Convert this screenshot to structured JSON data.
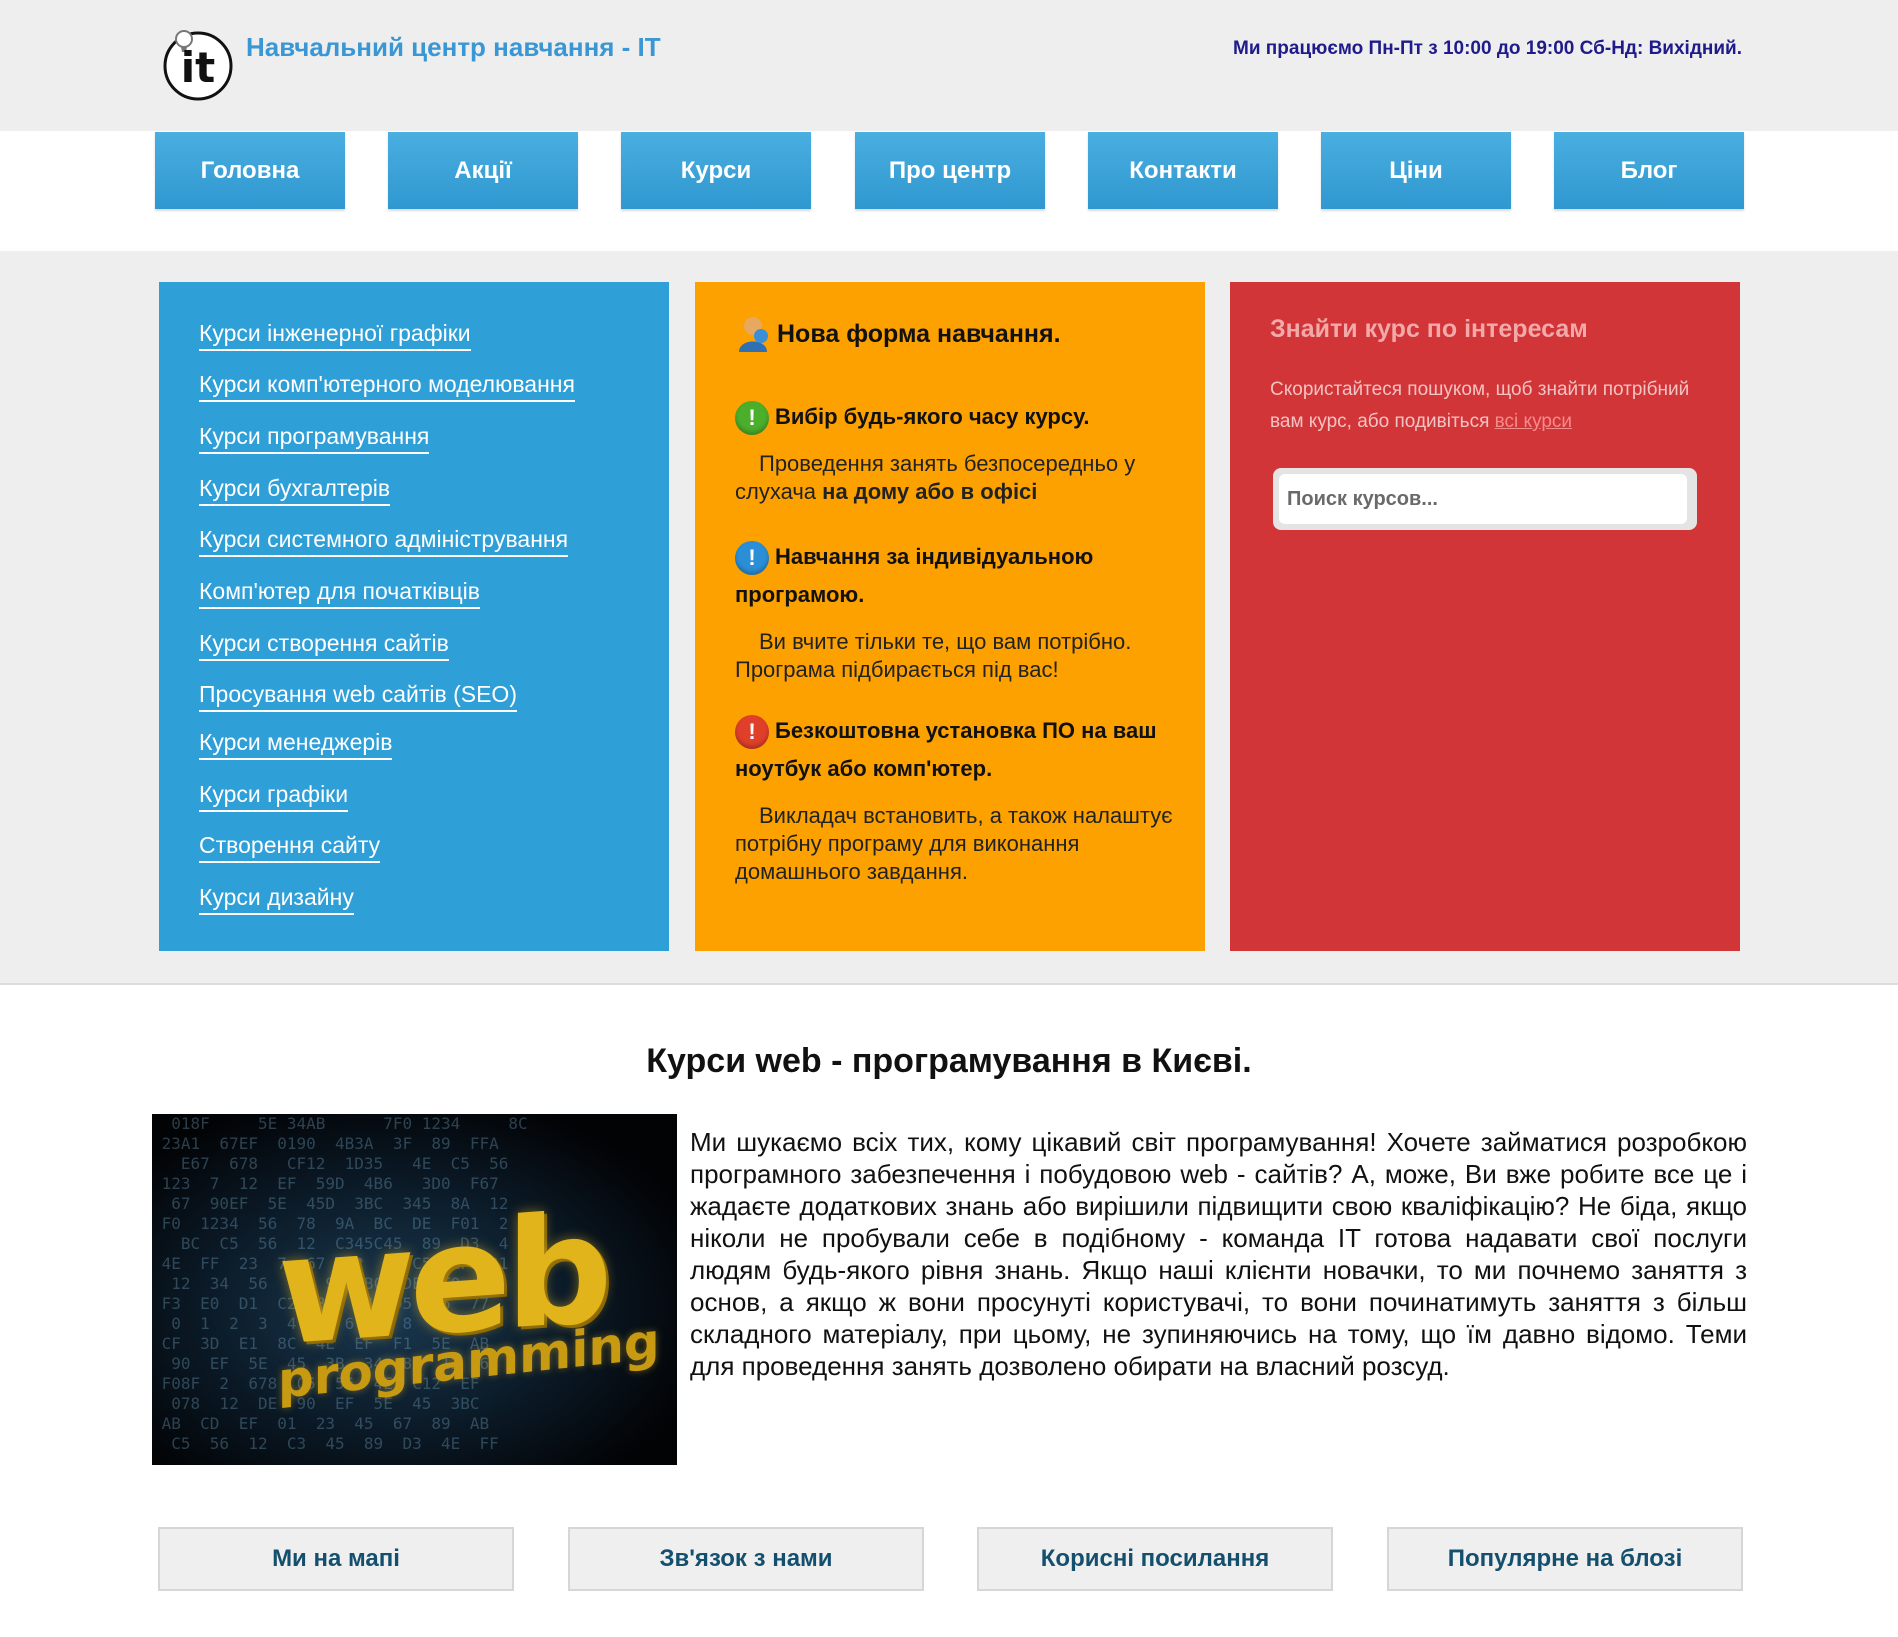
{
  "header": {
    "logo_text": "it",
    "site_title": "Навчальний центр навчання - IT",
    "work_hours": "Ми працюємо Пн-Пт з 10:00 до 19:00 Сб-Нд: Вихідний."
  },
  "nav": {
    "items": [
      {
        "label": "Головна"
      },
      {
        "label": "Акції"
      },
      {
        "label": "Курси"
      },
      {
        "label": "Про центр"
      },
      {
        "label": "Контакти"
      },
      {
        "label": "Ціни"
      },
      {
        "label": "Блог"
      }
    ]
  },
  "courses_panel": {
    "items": [
      {
        "label": "Курси інженерної графіки"
      },
      {
        "label": "Курси комп'ютерного моделювання"
      },
      {
        "label": "Курси програмування"
      },
      {
        "label": "Курси бухгалтерів"
      },
      {
        "label": "Курси системного адміністрування"
      },
      {
        "label": "Комп'ютер для початківців"
      },
      {
        "label": "Курси створення сайтів"
      },
      {
        "label": "Просування web сайтів (SEO)"
      },
      {
        "label": "Курси менеджерів"
      },
      {
        "label": "Курси графіки"
      },
      {
        "label": "Створення сайту"
      },
      {
        "label": "Курси дизайну"
      }
    ]
  },
  "feature_panel": {
    "title": "Нова форма навчання.",
    "features": [
      {
        "icon": "exclamation-green-icon",
        "heading": "Вибір будь-якого часу курсу.",
        "text_before": "Проведення занять безпосередньо у слухача ",
        "text_bold": "на дому або в офісі"
      },
      {
        "icon": "exclamation-blue-icon",
        "heading": "Навчання за індивідуальною програмою.",
        "text": "Ви вчите тільки те, що вам потрібно. Програма підбирається під вас!"
      },
      {
        "icon": "exclamation-red-icon",
        "heading": "Безкоштовна установка ПО на ваш ноутбук або комп'ютер.",
        "text": "Викладач встановить, а також налаштує потрібну програму для виконання домашнього завдання."
      }
    ]
  },
  "search_panel": {
    "title": "Знайти курс по інтересам",
    "description": "Скористайтеся пошуком, щоб знайти потрібний вам курс, або подивіться ",
    "all_courses_link": "всі курси",
    "search_placeholder": "Поиск курсов..."
  },
  "article": {
    "title": "Курси web - програмування в Києві.",
    "image_word_main": "web",
    "image_word_sub": "programming",
    "body": "Ми шукаємо всіх тих, кому цікавий світ програмування! Хочете займатися розробкою програмного забезпечення і побудовою web - сайтів? А, може, Ви вже робите все це і жадаєте додаткових знань або вирішили підвищити свою кваліфікацію? Не біда, якщо ніколи не пробували себе в подібному - команда IT готова надавати свої послуги людям будь-якого рівня знань. Якщо наші клієнти новачки, то ми почнемо заняття з основ, а якщо ж вони просунуті користувачі, то вони починатимуть заняття з більш складного матеріалу, при цьому, не зупиняючись на тому, що їм давно відомо. Теми для проведення занять дозволено обирати на власний розсуд."
  },
  "footer": {
    "buttons": [
      {
        "label": "Ми на мапі"
      },
      {
        "label": "Зв'язок з нами"
      },
      {
        "label": "Корисні посилання"
      },
      {
        "label": "Популярне на блозі"
      }
    ]
  },
  "colors": {
    "nav_blue": "#2f98d0",
    "panel_blue": "#2f9fd8",
    "panel_orange": "#fca100",
    "panel_red": "#d13538",
    "title_blue": "#3a97d4"
  }
}
